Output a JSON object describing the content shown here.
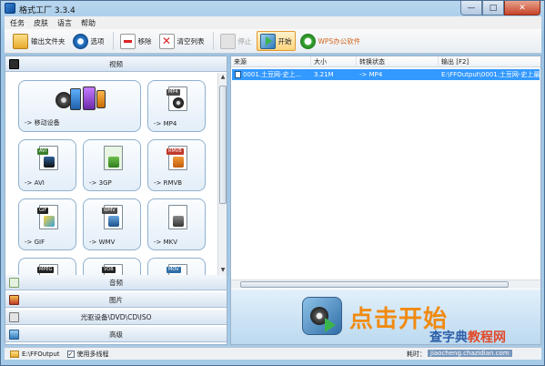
{
  "window": {
    "title": "格式工厂 3.3.4",
    "controls": [
      "—",
      "□",
      "✕"
    ]
  },
  "menu": [
    "任务",
    "皮肤",
    "语言",
    "帮助"
  ],
  "toolbar": {
    "output_folder": "输出文件夹",
    "options": "选项",
    "remove": "移除",
    "clear_list": "清空列表",
    "stop": "停止",
    "start": "开始",
    "wps": "WPS办公软件"
  },
  "categories": {
    "video": "视频",
    "audio": "音频",
    "picture": "图片",
    "disc": "光驱设备\\DVD\\CD\\ISO",
    "advanced": "高级"
  },
  "tiles": [
    {
      "label": "-> 移动设备",
      "tag": "",
      "color": "#2f6ea8"
    },
    {
      "label": "-> MP4",
      "tag": "MP4",
      "color": "#4b4b4b"
    },
    {
      "label": "-> AVI",
      "tag": "AVI",
      "color": "#3a7d2c"
    },
    {
      "label": "-> 3GP",
      "tag": "",
      "color": "#3a7d2c"
    },
    {
      "label": "-> RMVB",
      "tag": "RMVB",
      "color": "#c0392b"
    },
    {
      "label": "-> GIF",
      "tag": "GIF",
      "color": "#222222"
    },
    {
      "label": "-> WMV",
      "tag": "WMV",
      "color": "#4b4b4b"
    },
    {
      "label": "-> MKV",
      "tag": "",
      "color": "#4b4b4b"
    },
    {
      "label": "",
      "tag": "MPEG",
      "color": "#222222"
    },
    {
      "label": "",
      "tag": "VOB",
      "color": "#222222"
    },
    {
      "label": "",
      "tag": "MOV",
      "color": "#2f6ea8"
    }
  ],
  "table": {
    "headers": [
      "来源",
      "大小",
      "转换状态",
      "输出 [F2]"
    ],
    "rows": [
      {
        "source": "0001.土豆网-史上...",
        "size": "3.21M",
        "status": "-> MP4",
        "output": "E:\\FFOutput\\0001.土豆网-史上最"
      }
    ]
  },
  "promo": {
    "text": "点击开始"
  },
  "status": {
    "output_path": "E:\\FFOutput",
    "multithread": "使用多线程",
    "elapsed": "耗时："
  },
  "watermark": {
    "top_a": "查字典",
    "top_b": "教程网",
    "bottom": "jiaocheng.chazidian.com"
  }
}
